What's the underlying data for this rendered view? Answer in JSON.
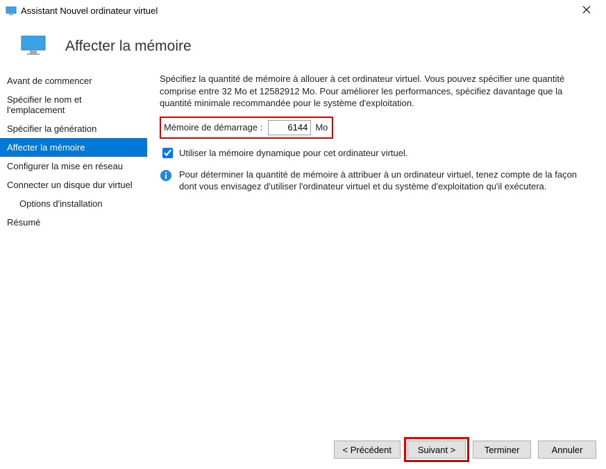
{
  "titlebar": {
    "title": "Assistant Nouvel ordinateur virtuel"
  },
  "header": {
    "page_title": "Affecter la mémoire"
  },
  "sidebar": {
    "items": [
      {
        "label": "Avant de commencer"
      },
      {
        "label": "Spécifier le nom et l'emplacement"
      },
      {
        "label": "Spécifier la génération"
      },
      {
        "label": "Affecter la mémoire"
      },
      {
        "label": "Configurer la mise en réseau"
      },
      {
        "label": "Connecter un disque dur virtuel"
      },
      {
        "label": "Options d'installation"
      },
      {
        "label": "Résumé"
      }
    ]
  },
  "content": {
    "description": "Spécifiez la quantité de mémoire à allouer à cet ordinateur virtuel. Vous pouvez spécifier une quantité comprise entre 32 Mo et 12582912 Mo. Pour améliorer les performances, spécifiez davantage que la quantité minimale recommandée pour le système d'exploitation.",
    "memory_label": "Mémoire de démarrage :",
    "memory_value": "6144",
    "memory_unit": "Mo",
    "dynamic_label": "Utiliser la mémoire dynamique pour cet ordinateur virtuel.",
    "info_text": "Pour déterminer la quantité de mémoire à attribuer à un ordinateur virtuel, tenez compte de la façon dont vous envisagez d'utiliser l'ordinateur virtuel et du système d'exploitation qu'il exécutera."
  },
  "footer": {
    "back": "< Précédent",
    "next": "Suivant >",
    "finish": "Terminer",
    "cancel": "Annuler"
  }
}
